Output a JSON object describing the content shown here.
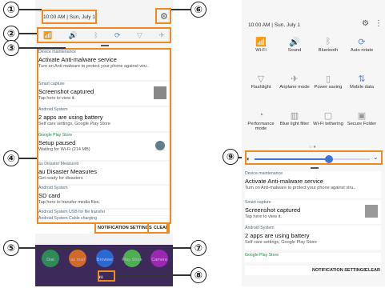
{
  "callouts": [
    "①",
    "②",
    "③",
    "④",
    "⑤",
    "⑥",
    "⑦",
    "⑧",
    "⑨"
  ],
  "left": {
    "time": "10:00 AM",
    "date": "Sun, July 1",
    "notifications": [
      {
        "src": "Device maintenance",
        "ttl": "Activate Anti-malware service",
        "sub": "Turn on Anti-malware to protect your phone against viru.."
      },
      {
        "src": "Smart capture",
        "ttl": "Screenshot captured",
        "sub": "Tap here to view it."
      },
      {
        "src": "Android System",
        "ttl": "2 apps are using battery",
        "sub": "Self care settings, Google Play Store"
      },
      {
        "src": "Google Play Store",
        "ttl": "Setup paused",
        "sub": "Waiting for Wi-Fi (214 MB)"
      },
      {
        "src": "au Disaster Measures",
        "ttl": "au Disaster Measures",
        "sub": "Get ready for disasters"
      },
      {
        "src": "Android System",
        "ttl": "SD card",
        "sub": "Tap here to transfer media files."
      }
    ],
    "extra_rows": [
      "Android System  USB for file transfer",
      "Android System  Cable charging"
    ],
    "actions": {
      "settings": "NOTIFICATION SETTINGS",
      "clear": "CLEAR"
    },
    "apps": [
      "Dial",
      "au mail",
      "Browser",
      "Play Store",
      "Camera"
    ],
    "carrier": "au"
  },
  "right": {
    "time": "10:00 AM",
    "date": "Sun, July 1",
    "tiles": [
      {
        "label": "Wi-Fi",
        "icon": "wifi-icon"
      },
      {
        "label": "Sound",
        "icon": "sound-icon"
      },
      {
        "label": "Bluetooth",
        "icon": "bluetooth-icon"
      },
      {
        "label": "Auto rotate",
        "icon": "rotate-icon"
      },
      {
        "label": "Flashlight",
        "icon": "flashlight-icon"
      },
      {
        "label": "Airplane mode",
        "icon": "airplane-icon"
      },
      {
        "label": "Power saving",
        "icon": "battery-icon"
      },
      {
        "label": "Mobile data",
        "icon": "data-icon"
      },
      {
        "label": "Performance mode",
        "icon": "performance-icon"
      },
      {
        "label": "Blue light filter",
        "icon": "bluelight-icon"
      },
      {
        "label": "Wi-Fi tethering",
        "icon": "tethering-icon"
      },
      {
        "label": "Secure Folder",
        "icon": "folder-icon"
      }
    ],
    "notifications": [
      {
        "src": "Device maintenance",
        "ttl": "Activate Anti-malware service",
        "sub": "Turn on Anti-malware to protect your phone against viru.."
      },
      {
        "src": "Smart capture",
        "ttl": "Screenshot captured",
        "sub": "Tap here to view it."
      },
      {
        "src": "Android System",
        "ttl": "2 apps are using battery",
        "sub": "Self care settings, Google Play Store"
      },
      {
        "src": "Google Play Store",
        "ttl": "",
        "sub": ""
      }
    ],
    "actions": {
      "settings": "NOTIFICATION SETTINGS",
      "clear": "CLEAR"
    }
  }
}
